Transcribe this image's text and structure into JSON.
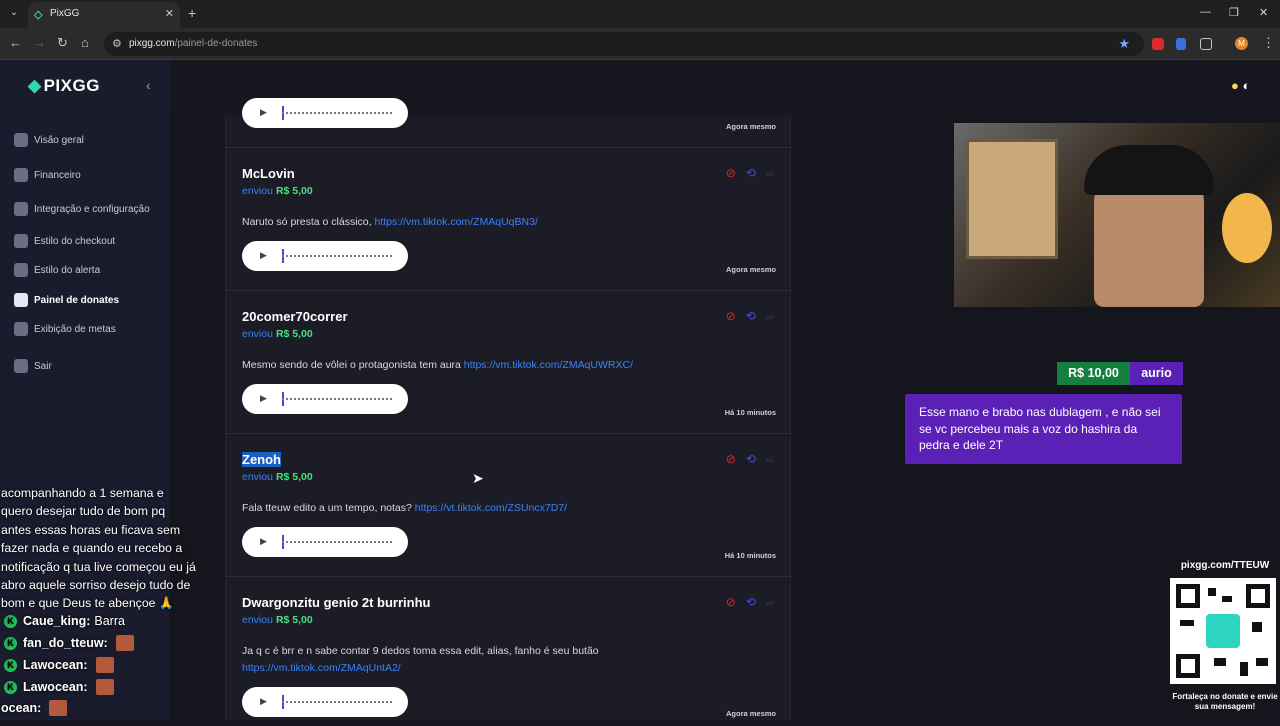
{
  "browser": {
    "tab_title": "PixGG",
    "url_host": "pixgg.com",
    "url_path": "/painel-de-donates",
    "profile_initial": "M"
  },
  "sidebar": {
    "logo": "PIXGG",
    "items": [
      {
        "label": "Visão geral",
        "icon": "home-icon"
      },
      {
        "label": "Financeiro",
        "icon": "wallet-icon"
      },
      {
        "label": "Integração e configuração",
        "icon": "plug-icon"
      },
      {
        "label": "Estilo do checkout",
        "icon": "palette-icon"
      },
      {
        "label": "Estilo do alerta",
        "icon": "bell-icon"
      },
      {
        "label": "Painel de donates",
        "icon": "list-icon"
      },
      {
        "label": "Exibição de metas",
        "icon": "star-icon"
      },
      {
        "label": "Sair",
        "icon": "logout-icon"
      }
    ],
    "active_index": 5
  },
  "donations": [
    {
      "name": "",
      "sent_label": "",
      "amount": "",
      "message": "",
      "link": "",
      "time": "Agora mesmo"
    },
    {
      "name": "McLovin",
      "sent_label": "enviou",
      "amount": "R$ 5,00",
      "message": "Naruto só presta o clássico, ",
      "link": "https://vm.tiktok.com/ZMAqUqBN3/",
      "time": "Agora mesmo"
    },
    {
      "name": "20comer70correr",
      "sent_label": "enviou",
      "amount": "R$ 5,00",
      "message": "Mesmo sendo de vôlei o protagonista tem aura ",
      "link": "https://vm.tiktok.com/ZMAqUWRXC/",
      "time": "Há 10 minutos"
    },
    {
      "name": "Zenoh",
      "sent_label": "enviou",
      "amount": "R$ 5,00",
      "message": "Fala tteuw edito a um tempo, notas? ",
      "link": "https://vt.tiktok.com/ZSUncx7D7/",
      "time": "Há 10 minutos"
    },
    {
      "name": "Dwargonzitu genio 2t burrinhu",
      "sent_label": "enviou",
      "amount": "R$ 5,00",
      "message": "Ja q c é brr e n sabe contar 9 dedos toma essa edit, alias, fanho é seu butão ",
      "link": "https://vm.tiktok.com/ZMAqUntA2/",
      "time": "Agora mesmo"
    }
  ],
  "alert": {
    "amount": "R$ 10,00",
    "user": "aurio",
    "message": "Esse mano e brabo nas dublagem , e não sei se vc percebeu mais a voz do hashira da pedra e dele 2T"
  },
  "qr": {
    "url": "pixgg.com/TTEUW",
    "caption": "Fortaleça no donate e envie sua mensagem!"
  },
  "chat": {
    "text": "acompanhando a 1 semana e quero desejar tudo de bom pq antes essas horas eu ficava sem fazer nada e quando eu recebo a notificação q tua live começou eu já abro aquele sorriso desejo tudo de bom e que Deus te abençoe 🙏",
    "lines": [
      {
        "user": "Caue_king:",
        "text": "Barra"
      },
      {
        "user": "fan_do_tteuw:",
        "text": ""
      },
      {
        "user": "Lawocean:",
        "text": ""
      },
      {
        "user": "Lawocean:",
        "text": ""
      },
      {
        "user": "ocean:",
        "text": ""
      }
    ]
  }
}
